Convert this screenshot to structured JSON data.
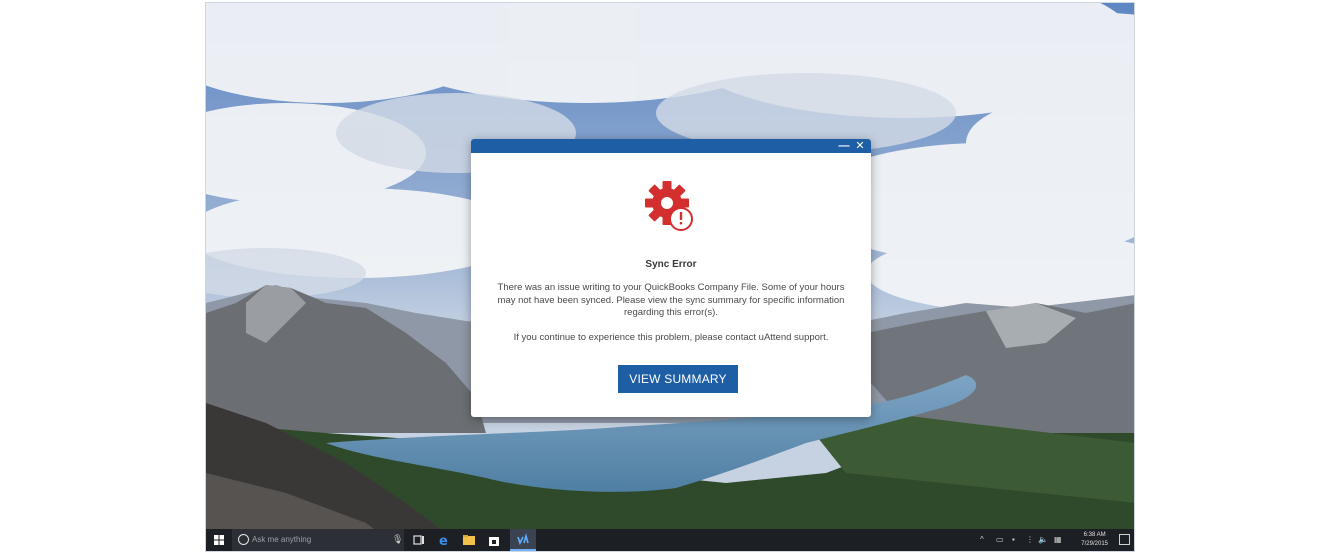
{
  "dialog": {
    "minimize_label": "—",
    "close_label": "✕",
    "icon": "gear-error-icon",
    "title": "Sync Error",
    "message": "There was an issue writing to your QuickBooks Company File. Some of your hours may not have been synced. Please view the sync summary for specific information regarding this error(s).",
    "message2": "If you continue to experience this problem, please contact uAttend support.",
    "button_label": "VIEW SUMMARY",
    "colors": {
      "titlebar": "#1d5ea5",
      "button": "#1d5ea5",
      "icon": "#d32f2f"
    }
  },
  "taskbar": {
    "search_placeholder": "Ask me anything",
    "apps": [
      "task-view-icon",
      "edge-icon",
      "file-explorer-icon",
      "store-icon",
      "uattend-icon"
    ],
    "clock_time": "6:38 AM",
    "clock_date": "7/29/2015"
  }
}
